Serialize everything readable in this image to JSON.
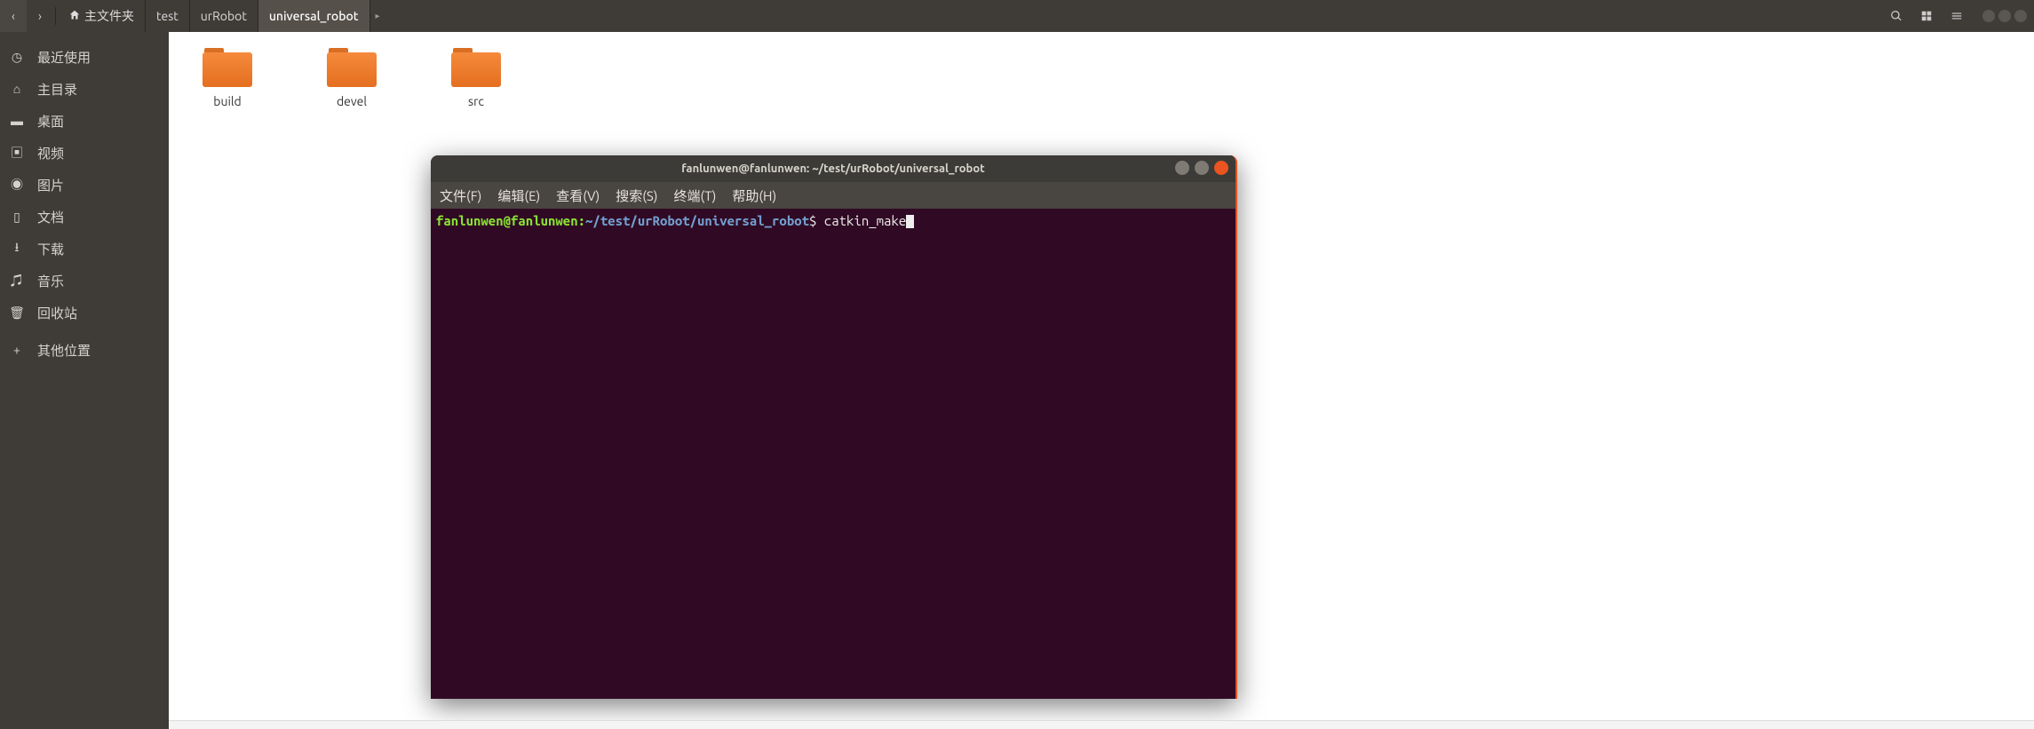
{
  "topbar": {
    "back_icon": "‹",
    "fwd_icon": "›",
    "breadcrumbs": [
      "主文件夹",
      "test",
      "urRobot",
      "universal_robot"
    ]
  },
  "sidebar": {
    "items": [
      {
        "icon": "clock",
        "label": "最近使用"
      },
      {
        "icon": "home",
        "label": "主目录"
      },
      {
        "icon": "folder",
        "label": "桌面"
      },
      {
        "icon": "video",
        "label": "视频"
      },
      {
        "icon": "camera",
        "label": "图片"
      },
      {
        "icon": "doc",
        "label": "文档"
      },
      {
        "icon": "download",
        "label": "下载"
      },
      {
        "icon": "music",
        "label": "音乐"
      },
      {
        "icon": "trash",
        "label": "回收站"
      },
      {
        "icon": "plus",
        "label": "其他位置"
      }
    ]
  },
  "folders": [
    {
      "label": "build"
    },
    {
      "label": "devel"
    },
    {
      "label": "src"
    }
  ],
  "terminal": {
    "title": "fanlunwen@fanlunwen: ~/test/urRobot/universal_robot",
    "menus": [
      "文件(F)",
      "编辑(E)",
      "查看(V)",
      "搜索(S)",
      "终端(T)",
      "帮助(H)"
    ],
    "prompt_user": "fanlunwen@fanlunwen",
    "prompt_colon": ":",
    "prompt_path": "~/test/urRobot/universal_robot",
    "prompt_dollar": "$ ",
    "command": "catkin_make"
  }
}
